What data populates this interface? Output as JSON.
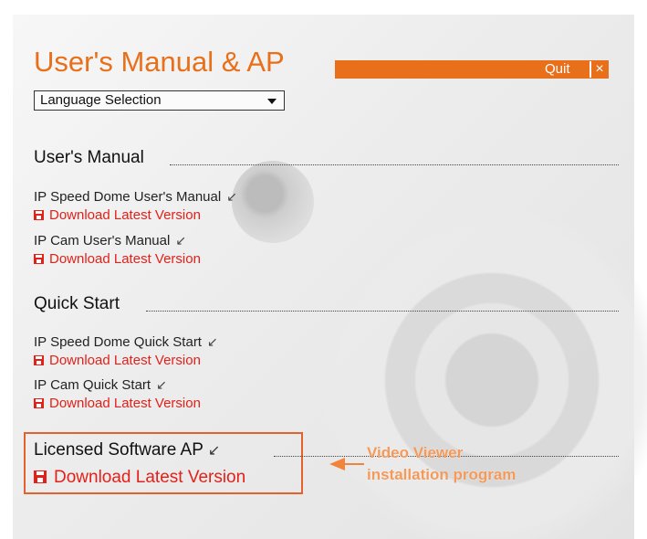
{
  "header": {
    "title": "User's Manual & AP",
    "quit_label": "Quit",
    "quit_icon": "×"
  },
  "language": {
    "selected": "Language Selection"
  },
  "sections": {
    "manual": {
      "heading": "User's Manual",
      "items": [
        {
          "label": "IP Speed Dome User's Manual",
          "pointer": "↙",
          "download": "Download Latest Version"
        },
        {
          "label": "IP Cam User's Manual",
          "pointer": "↙",
          "download": "Download Latest Version"
        }
      ]
    },
    "quickstart": {
      "heading": "Quick Start",
      "items": [
        {
          "label": "IP Speed Dome Quick Start",
          "pointer": "↙",
          "download": "Download Latest Version"
        },
        {
          "label": "IP Cam Quick Start",
          "pointer": "↙",
          "download": "Download Latest Version"
        }
      ]
    },
    "licensed": {
      "heading": "Licensed Software AP",
      "pointer": "↙",
      "download": "Download Latest Version"
    }
  },
  "callout": {
    "line1": "Video Viewer",
    "line2": "installation program"
  },
  "colors": {
    "accent": "#e8701a",
    "download": "#e2211a",
    "callout": "#f39a5b"
  },
  "icons": {
    "quit": "close-icon",
    "download": "floppy-disk-icon",
    "pointer": "arrow-down-left-icon",
    "dropdown": "chevron-down-icon"
  }
}
